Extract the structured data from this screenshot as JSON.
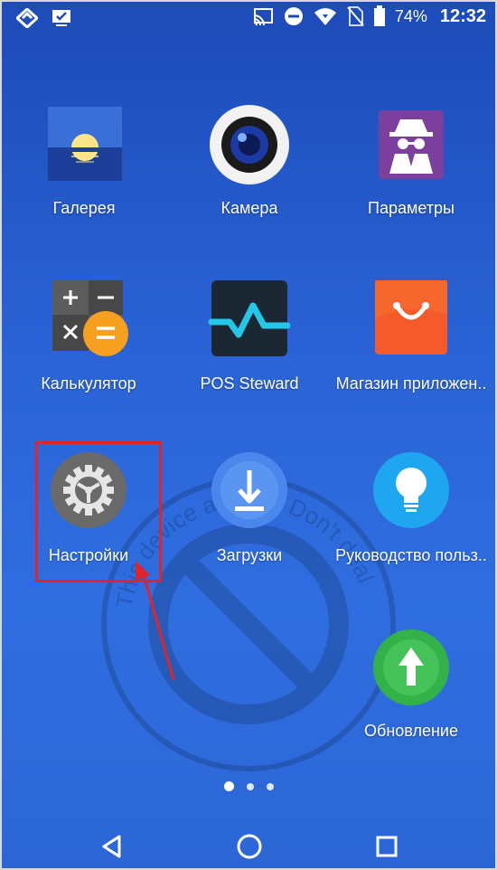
{
  "status": {
    "battery": "74%",
    "time": "12:32"
  },
  "apps": {
    "gallery": "Галерея",
    "camera": "Камера",
    "params": "Параметры",
    "calculator": "Калькулятор",
    "pos": "POS Steward",
    "store": "Магазин приложен..",
    "settings": "Настройки",
    "downloads": "Загрузки",
    "guide": "Руководство польз..",
    "update": "Обновление"
  },
  "watermark": {
    "text": "This device at risk - Don't deal"
  },
  "pager": {
    "pages": 3,
    "active": 1
  },
  "colors": {
    "highlight": "#e0242a",
    "background": "#2a63d6"
  }
}
